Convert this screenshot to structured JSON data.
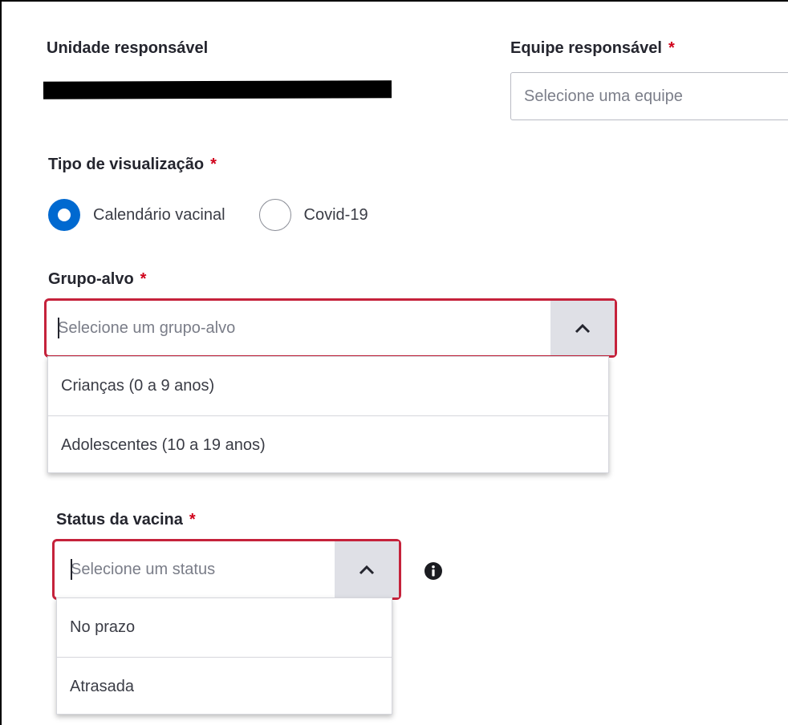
{
  "unit": {
    "label": "Unidade responsável"
  },
  "team": {
    "label": "Equipe responsável",
    "required": "*",
    "placeholder": "Selecione uma equipe"
  },
  "view_type": {
    "label": "Tipo de visualização",
    "required": "*",
    "options": [
      {
        "label": "Calendário vacinal",
        "selected": true
      },
      {
        "label": "Covid-19",
        "selected": false
      }
    ]
  },
  "target_group": {
    "label": "Grupo-alvo",
    "required": "*",
    "placeholder": "Selecione um grupo-alvo",
    "options": [
      "Crianças (0 a 9 anos)",
      "Adolescentes (10 a 19 anos)"
    ]
  },
  "vaccine_status": {
    "label": "Status da vacina",
    "required": "*",
    "placeholder": "Selecione um status",
    "options": [
      "No prazo",
      "Atrasada"
    ]
  },
  "colors": {
    "primary": "#0069d0",
    "error": "#c5223b",
    "required": "#d0021b"
  },
  "icons": {
    "toggle": "chevron-up-icon",
    "info": "info-icon"
  }
}
